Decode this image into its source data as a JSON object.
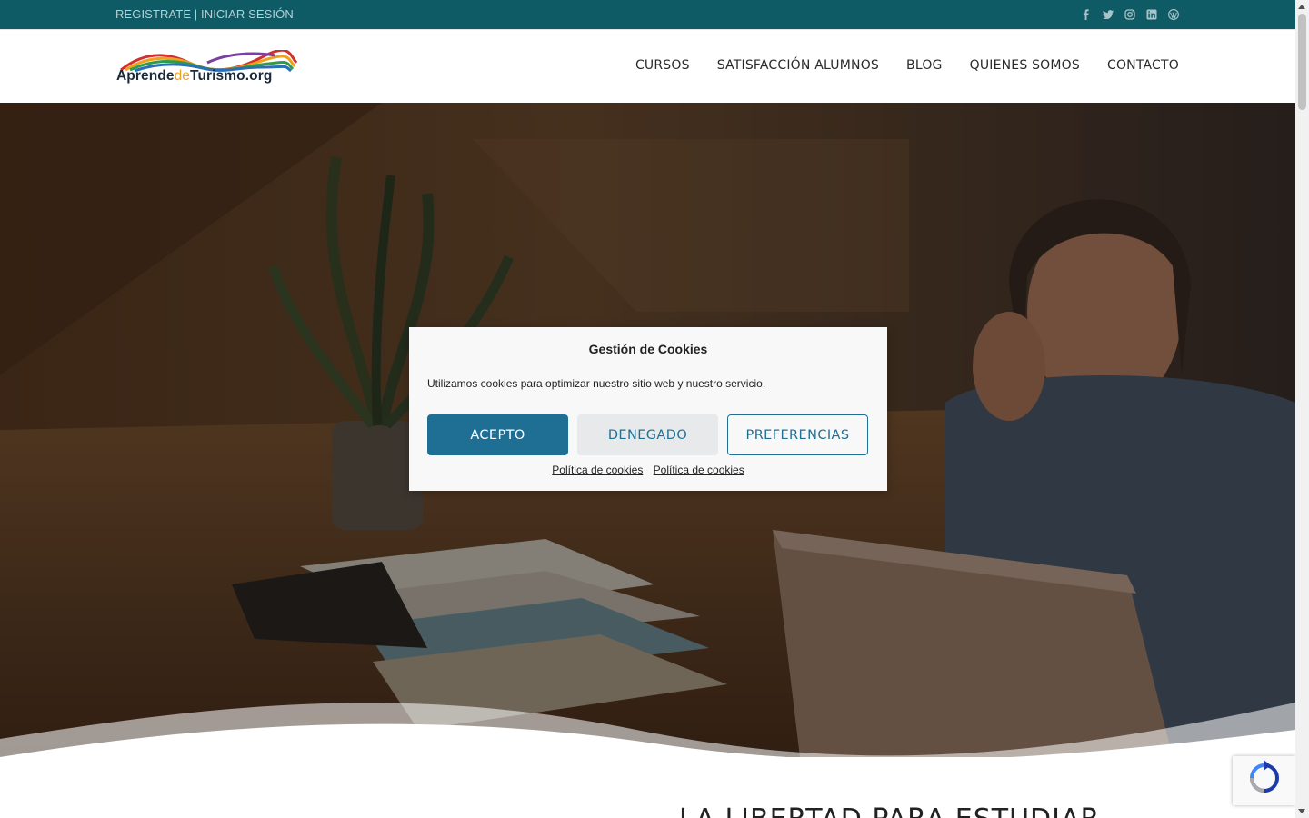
{
  "topbar": {
    "auth_text": "REGISTRATE | INICIAR SESIÓN",
    "social": [
      {
        "icon": "facebook-icon",
        "glyph": "f"
      },
      {
        "icon": "twitter-icon",
        "glyph": "🐦"
      },
      {
        "icon": "instagram-icon",
        "glyph": "◎"
      },
      {
        "icon": "linkedin-icon",
        "glyph": "in"
      },
      {
        "icon": "wordpress-icon",
        "glyph": "W"
      }
    ]
  },
  "header": {
    "logo_text_1": "Aprende",
    "logo_text_2": "de",
    "logo_text_3": "Turismo.org",
    "nav": [
      "CURSOS",
      "SATISFACCIÓN ALUMNOS",
      "BLOG",
      "QUIENES SOMOS",
      "CONTACTO"
    ]
  },
  "main": {
    "section_title": "LA LIBERTAD PARA ESTUDIAR"
  },
  "cookie": {
    "title": "Gestión de Cookies",
    "message": "Utilizamos cookies para optimizar nuestro sitio web y nuestro servicio.",
    "accept_label": "ACEPTO",
    "deny_label": "DENEGADO",
    "prefs_label": "PREFERENCIAS",
    "link_1": "Política de cookies",
    "link_2": "Política de cookies"
  },
  "colors": {
    "topbar": "#0e5b66",
    "accent": "#1f6f94"
  }
}
